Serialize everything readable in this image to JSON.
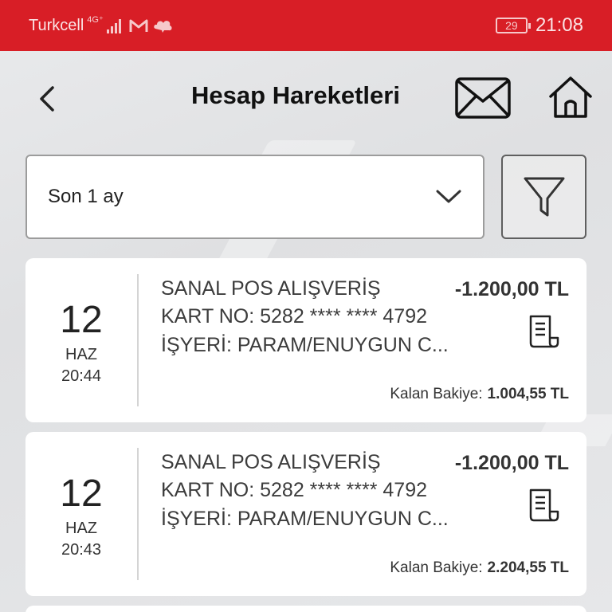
{
  "status_bar": {
    "carrier": "Turkcell",
    "network": "4G⁺",
    "battery": "29",
    "time": "21:08",
    "bar_color": "#d81e26"
  },
  "header": {
    "title": "Hesap Hareketleri",
    "back_icon": "chevron-left-icon",
    "mail_icon": "envelope-icon",
    "home_icon": "home-icon"
  },
  "filter": {
    "period_value": "Son 1 ay",
    "dropdown_icon": "chevron-down-icon",
    "filter_icon": "funnel-icon"
  },
  "transactions": [
    {
      "day": "12",
      "month": "HAZ",
      "time": "20:44",
      "description": "SANAL POS ALIŞVERİŞ",
      "card_no": "KART NO: 5282 **** **** 4792",
      "merchant": "İŞYERİ: PARAM/ENUYGUN C...",
      "amount": "-1.200,00 TL",
      "balance_label": "Kalan Bakiye:",
      "balance_value": "1.004,55 TL"
    },
    {
      "day": "12",
      "month": "HAZ",
      "time": "20:43",
      "description": "SANAL POS ALIŞVERİŞ",
      "card_no": "KART NO: 5282 **** **** 4792",
      "merchant": "İŞYERİ: PARAM/ENUYGUN C...",
      "amount": "-1.200,00 TL",
      "balance_label": "Kalan Bakiye:",
      "balance_value": "2.204,55 TL"
    }
  ]
}
